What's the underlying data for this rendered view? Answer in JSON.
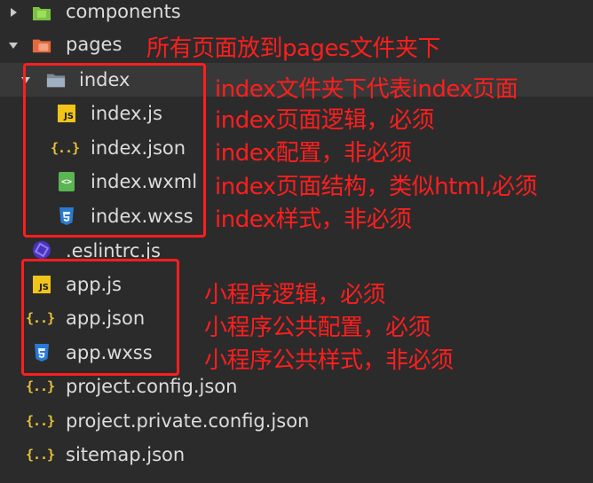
{
  "tree": {
    "components": "components",
    "pages": "pages",
    "index_folder": "index",
    "index_js": "index.js",
    "index_json": "index.json",
    "index_wxml": "index.wxml",
    "index_wxss": "index.wxss",
    "eslintrc": ".eslintrc.js",
    "app_js": "app.js",
    "app_json": "app.json",
    "app_wxss": "app.wxss",
    "project_config": "project.config.json",
    "project_private_config": "project.private.config.json",
    "sitemap": "sitemap.json"
  },
  "notes": {
    "pages": "所有页面放到pages文件夹下",
    "index_folder": "index文件夹下代表index页面",
    "index_js": "index页面逻辑，必须",
    "index_json": "index配置，非必须",
    "index_wxml": "index页面结构，类似html,必须",
    "index_wxss": "index样式，非必须",
    "app_js": "小程序逻辑，必须",
    "app_json": "小程序公共配置，必须",
    "app_wxss": "小程序公共样式，非必须"
  },
  "icons": {
    "js_text": "JS",
    "json_text": "{..}",
    "wxml_text": "<>",
    "wxss_text": "3"
  },
  "colors": {
    "annotation": "#ff1e1e",
    "background": "#2b2b2b",
    "selected_row": "#383838"
  }
}
